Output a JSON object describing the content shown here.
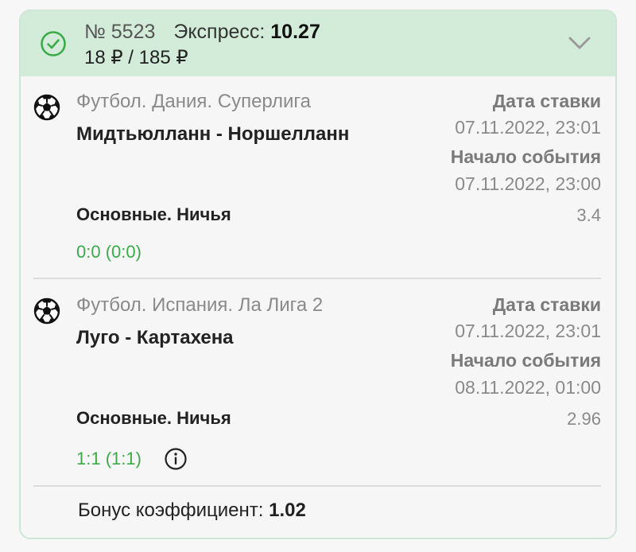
{
  "header": {
    "bet_number": "№ 5523",
    "bet_type": "Экспресс:",
    "total_coef": "10.27",
    "stake_payout": "18 ₽ / 185 ₽",
    "status_color": "#3bab4a"
  },
  "events": [
    {
      "league": "Футбол. Дания. Суперлига",
      "teams": "Мидтьюлланн - Норшелланн",
      "bet_date_label": "Дата ставки",
      "bet_date": "07.11.2022, 23:01",
      "event_start_label": "Начало события",
      "event_start": "07.11.2022, 23:00",
      "market": "Основные. Ничья",
      "odds": "3.4",
      "score": "0:0 (0:0)"
    },
    {
      "league": "Футбол. Испания. Ла Лига 2",
      "teams": "Луго - Картахена",
      "bet_date_label": "Дата ставки",
      "bet_date": "07.11.2022, 23:01",
      "event_start_label": "Начало события",
      "event_start": "08.11.2022, 01:00",
      "market": "Основные. Ничья",
      "odds": "2.96",
      "score": "1:1 (1:1)"
    }
  ],
  "bonus": {
    "label": "Бонус коэффициент:",
    "value": "1.02"
  }
}
